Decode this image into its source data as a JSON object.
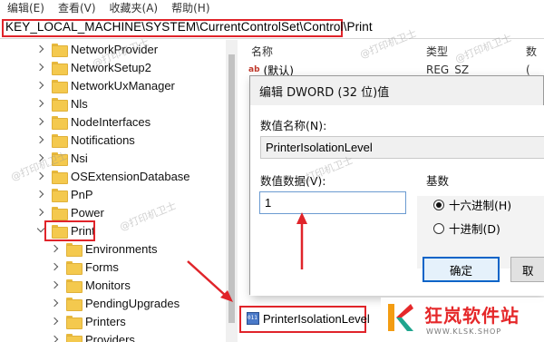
{
  "menu": [
    "编辑(E)",
    "查看(V)",
    "收藏夹(A)",
    "帮助(H)"
  ],
  "address": "KEY_LOCAL_MACHINE\\SYSTEM\\CurrentControlSet\\Control\\Print",
  "tree": [
    {
      "label": "NetworkProvider",
      "expanded": false
    },
    {
      "label": "NetworkSetup2",
      "expanded": false
    },
    {
      "label": "NetworkUxManager",
      "expanded": false
    },
    {
      "label": "Nls",
      "expanded": false
    },
    {
      "label": "NodeInterfaces",
      "expanded": false
    },
    {
      "label": "Notifications",
      "expanded": false
    },
    {
      "label": "Nsi",
      "expanded": false
    },
    {
      "label": "OSExtensionDatabase",
      "expanded": false
    },
    {
      "label": "PnP",
      "expanded": false
    },
    {
      "label": "Power",
      "expanded": false
    },
    {
      "label": "Print",
      "expanded": true
    },
    {
      "label": "Environments",
      "expanded": false
    },
    {
      "label": "Forms",
      "expanded": false
    },
    {
      "label": "Monitors",
      "expanded": false
    },
    {
      "label": "PendingUpgrades",
      "expanded": false
    },
    {
      "label": "Printers",
      "expanded": false
    },
    {
      "label": "Providers",
      "expanded": false
    }
  ],
  "columns": {
    "name": "名称",
    "type": "类型",
    "data": "数"
  },
  "values_rows": [
    {
      "name": "(默认)",
      "type": "REG_SZ",
      "data": "("
    }
  ],
  "dialog": {
    "title": "编辑 DWORD (32 位)值",
    "value_name_label": "数值名称(N):",
    "value_name": "PrinterIsolationLevel",
    "value_data_label": "数值数据(V):",
    "value_data": "1",
    "base_label": "基数",
    "hex_label": "十六进制(H)",
    "dec_label": "十进制(D)",
    "ok_label": "确定",
    "cancel_label": "取"
  },
  "selected_value": "PrinterIsolationLevel",
  "watermark": "@打印机卫士",
  "logo": {
    "name": "狂岚软件站",
    "url": "WWW.KLSK.SHOP"
  },
  "colors": {
    "highlight": "#e0242a",
    "folder": "#f4c94e",
    "dialog_bg": "#f0f0f0"
  }
}
